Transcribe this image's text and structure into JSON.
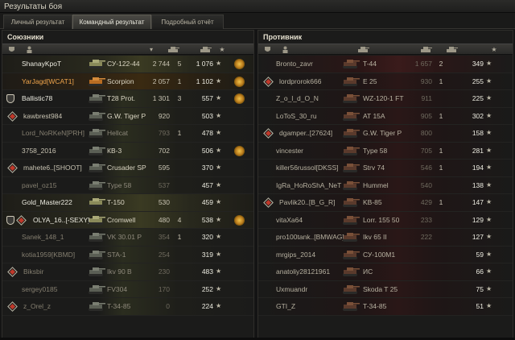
{
  "window": {
    "title": "Результаты боя"
  },
  "tabs": [
    {
      "label": "Личный результат",
      "active": false
    },
    {
      "label": "Командный результат",
      "active": true
    },
    {
      "label": "Подробный отчёт",
      "active": false
    }
  ],
  "allies": {
    "title": "Союзники",
    "rows": [
      {
        "player": "ShanayKpoT",
        "tank": "СУ-122-44",
        "damage": "2 744",
        "kills": "5",
        "xp": "1 076",
        "medal": true,
        "style": "gold",
        "name_style": "bright",
        "marker": ""
      },
      {
        "player": "YarJagd[WCAT1]",
        "tank": "Scorpion",
        "damage": "2 057",
        "kills": "1",
        "xp": "1 102",
        "medal": true,
        "style": "player",
        "name_style": "player",
        "marker": ""
      },
      {
        "player": "Ballistic78",
        "tank": "T28 Prot.",
        "damage": "1 301",
        "kills": "3",
        "xp": "557",
        "medal": true,
        "style": "ally",
        "name_style": "bright",
        "marker": "shield"
      },
      {
        "player": "kawbrest984",
        "tank": "G.W. Tiger P",
        "damage": "920",
        "kills": "",
        "xp": "503",
        "medal": false,
        "style": "ally",
        "name_style": "normal",
        "marker": "platoon"
      },
      {
        "player": "Lord_NoRKeN[PRH]",
        "tank": "Hellcat",
        "damage": "793",
        "kills": "1",
        "xp": "478",
        "medal": false,
        "style": "ally",
        "name_style": "dim",
        "marker": ""
      },
      {
        "player": "3758_2016",
        "tank": "КВ-3",
        "damage": "702",
        "kills": "",
        "xp": "506",
        "medal": true,
        "style": "ally",
        "name_style": "normal",
        "marker": ""
      },
      {
        "player": "mahete6..[SHOOT]",
        "tank": "Crusader SP",
        "damage": "595",
        "kills": "",
        "xp": "370",
        "medal": false,
        "style": "ally",
        "name_style": "normal",
        "marker": "platoon"
      },
      {
        "player": "pavel_oz15",
        "tank": "Type 58",
        "damage": "537",
        "kills": "",
        "xp": "457",
        "medal": false,
        "style": "ally",
        "name_style": "dim",
        "marker": ""
      },
      {
        "player": "Gold_Master222",
        "tank": "T-150",
        "damage": "530",
        "kills": "",
        "xp": "459",
        "medal": false,
        "style": "gold",
        "name_style": "bright",
        "marker": ""
      },
      {
        "player": "OLYA_16..[-SEXY]",
        "tank": "Cromwell",
        "damage": "480",
        "kills": "4",
        "xp": "538",
        "medal": true,
        "style": "gold",
        "name_style": "bright",
        "marker": "shield-platoon"
      },
      {
        "player": "Sanek_148_1",
        "tank": "VK 30.01 P",
        "damage": "354",
        "kills": "1",
        "xp": "320",
        "medal": false,
        "style": "ally",
        "name_style": "dim",
        "marker": ""
      },
      {
        "player": "kotia1959[KBMD]",
        "tank": "STA-1",
        "damage": "254",
        "kills": "",
        "xp": "319",
        "medal": false,
        "style": "ally",
        "name_style": "dim",
        "marker": ""
      },
      {
        "player": "Biksbir",
        "tank": "Ikv 90 B",
        "damage": "230",
        "kills": "",
        "xp": "483",
        "medal": false,
        "style": "ally",
        "name_style": "dim",
        "marker": "platoon"
      },
      {
        "player": "sergey0185",
        "tank": "FV304",
        "damage": "170",
        "kills": "",
        "xp": "252",
        "medal": false,
        "style": "ally",
        "name_style": "dim",
        "marker": ""
      },
      {
        "player": "z_Orel_z",
        "tank": "T-34-85",
        "damage": "0",
        "kills": "",
        "xp": "224",
        "medal": false,
        "style": "ally",
        "name_style": "dim",
        "marker": "platoon"
      }
    ]
  },
  "enemies": {
    "title": "Противник",
    "rows": [
      {
        "player": "Bronto_zavr",
        "tank": "T-44",
        "damage": "1 657",
        "kills": "2",
        "xp": "349",
        "platoon": false,
        "dead": false
      },
      {
        "player": "lordprorok666",
        "tank": "E 25",
        "damage": "930",
        "kills": "1",
        "xp": "255",
        "platoon": true,
        "dead": true
      },
      {
        "player": "Z_o_l_d_O_N",
        "tank": "WZ-120-1 FT",
        "damage": "911",
        "kills": "",
        "xp": "225",
        "platoon": false,
        "dead": true
      },
      {
        "player": "LoToS_30_ru",
        "tank": "AT 15A",
        "damage": "905",
        "kills": "1",
        "xp": "302",
        "platoon": false,
        "dead": true
      },
      {
        "player": "dgamper..[27624]",
        "tank": "G.W. Tiger P",
        "damage": "800",
        "kills": "",
        "xp": "158",
        "platoon": true,
        "dead": true
      },
      {
        "player": "vincester",
        "tank": "Type 58",
        "damage": "705",
        "kills": "1",
        "xp": "281",
        "platoon": false,
        "dead": true
      },
      {
        "player": "killer56russol[DKSS]",
        "tank": "Strv 74",
        "damage": "546",
        "kills": "1",
        "xp": "194",
        "platoon": false,
        "dead": true
      },
      {
        "player": "IgRa_HoRoShA_NeT",
        "tank": "Hummel",
        "damage": "540",
        "kills": "",
        "xp": "138",
        "platoon": false,
        "dead": true
      },
      {
        "player": "Pavlik20..[B_G_R]",
        "tank": "KB-85",
        "damage": "429",
        "kills": "1",
        "xp": "147",
        "platoon": true,
        "dead": true
      },
      {
        "player": "vitaXa64",
        "tank": "Lorr. 155 50",
        "damage": "233",
        "kills": "",
        "xp": "129",
        "platoon": false,
        "dead": true
      },
      {
        "player": "pro100tank..[BMWAG]",
        "tank": "Ikv 65 II",
        "damage": "222",
        "kills": "",
        "xp": "127",
        "platoon": false,
        "dead": true
      },
      {
        "player": "mrgips_2014",
        "tank": "СУ-100М1",
        "damage": "",
        "kills": "",
        "xp": "59",
        "platoon": false,
        "dead": true
      },
      {
        "player": "anatoliy28121961",
        "tank": "ИС",
        "damage": "",
        "kills": "",
        "xp": "66",
        "platoon": false,
        "dead": true
      },
      {
        "player": "Uxmuandr",
        "tank": "Skoda T 25",
        "damage": "",
        "kills": "",
        "xp": "75",
        "platoon": false,
        "dead": true
      },
      {
        "player": "GTI_Z",
        "tank": "T-34-85",
        "damage": "",
        "kills": "",
        "xp": "51",
        "platoon": false,
        "dead": true
      }
    ]
  },
  "icons": {
    "header_allies": [
      "shield-icon",
      "person-icon",
      "sort-arrow-icon",
      "tank-icon",
      "tank-icon",
      "star-icon"
    ],
    "header_enemies": [
      "shield-icon",
      "person-icon",
      "tank-icon",
      "tank-icon",
      "tank-icon",
      "star-icon"
    ],
    "row_star": "★"
  },
  "colors": {
    "player_name": "#f1a64c",
    "enemy_accent": "#3a1b1b",
    "medal": "#f0c24a"
  }
}
